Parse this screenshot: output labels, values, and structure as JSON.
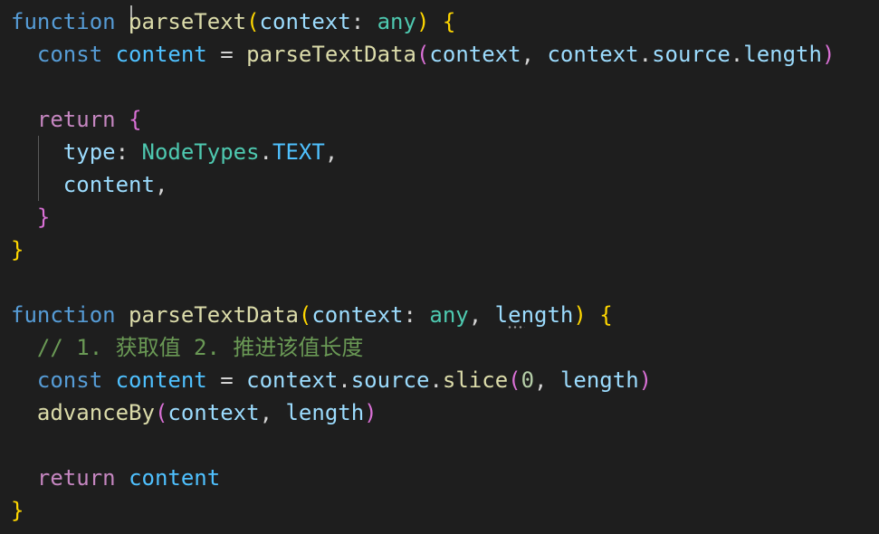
{
  "editor": {
    "language": "typescript",
    "theme_colors": {
      "background": "#1e1e1e",
      "keyword": "#569cd6",
      "control": "#c586c0",
      "function": "#dcdcaa",
      "parameter": "#9cdcfe",
      "constant": "#4fc1ff",
      "type": "#4ec9b0",
      "number": "#b5cea8",
      "comment": "#6a9955",
      "bracket_level1": "#ffd700",
      "bracket_level2": "#da70d6",
      "bracket_level3": "#179fff"
    },
    "lines": [
      [
        {
          "t": "function",
          "c": "kw"
        },
        {
          "t": " ",
          "c": "pun"
        },
        {
          "t": "parseText",
          "c": "fn"
        },
        {
          "t": "(",
          "c": "b1"
        },
        {
          "t": "context",
          "c": "param"
        },
        {
          "t": ": ",
          "c": "pun"
        },
        {
          "t": "any",
          "c": "type"
        },
        {
          "t": ")",
          "c": "b1"
        },
        {
          "t": " ",
          "c": "pun"
        },
        {
          "t": "{",
          "c": "b1"
        }
      ],
      [
        {
          "t": "  ",
          "c": "pun"
        },
        {
          "t": "const",
          "c": "kw"
        },
        {
          "t": " ",
          "c": "pun"
        },
        {
          "t": "content",
          "c": "var"
        },
        {
          "t": " = ",
          "c": "pun"
        },
        {
          "t": "parseTextData",
          "c": "fn"
        },
        {
          "t": "(",
          "c": "b2"
        },
        {
          "t": "context",
          "c": "param"
        },
        {
          "t": ", ",
          "c": "pun"
        },
        {
          "t": "context",
          "c": "param"
        },
        {
          "t": ".",
          "c": "pun"
        },
        {
          "t": "source",
          "c": "param"
        },
        {
          "t": ".",
          "c": "pun"
        },
        {
          "t": "length",
          "c": "param"
        },
        {
          "t": ")",
          "c": "b2"
        }
      ],
      [],
      [
        {
          "t": "  ",
          "c": "pun"
        },
        {
          "t": "return",
          "c": "ctl"
        },
        {
          "t": " ",
          "c": "pun"
        },
        {
          "t": "{",
          "c": "b2"
        }
      ],
      [
        {
          "t": "    ",
          "c": "pun"
        },
        {
          "t": "type",
          "c": "param"
        },
        {
          "t": ": ",
          "c": "pun"
        },
        {
          "t": "NodeTypes",
          "c": "type"
        },
        {
          "t": ".",
          "c": "pun"
        },
        {
          "t": "TEXT",
          "c": "var"
        },
        {
          "t": ",",
          "c": "pun"
        }
      ],
      [
        {
          "t": "    ",
          "c": "pun"
        },
        {
          "t": "content",
          "c": "param"
        },
        {
          "t": ",",
          "c": "pun"
        }
      ],
      [
        {
          "t": "  ",
          "c": "pun"
        },
        {
          "t": "}",
          "c": "b2"
        }
      ],
      [
        {
          "t": "}",
          "c": "b1"
        }
      ],
      [],
      [
        {
          "t": "function",
          "c": "kw"
        },
        {
          "t": " ",
          "c": "pun"
        },
        {
          "t": "parseTextData",
          "c": "fn"
        },
        {
          "t": "(",
          "c": "b1"
        },
        {
          "t": "context",
          "c": "param"
        },
        {
          "t": ": ",
          "c": "pun"
        },
        {
          "t": "any",
          "c": "type"
        },
        {
          "t": ", ",
          "c": "pun"
        },
        {
          "t": "length",
          "c": "param"
        },
        {
          "t": ")",
          "c": "b1"
        },
        {
          "t": " ",
          "c": "pun"
        },
        {
          "t": "{",
          "c": "b1"
        }
      ],
      [
        {
          "t": "  ",
          "c": "pun"
        },
        {
          "t": "// 1. 获取值 2. 推进该值长度",
          "c": "cmt"
        }
      ],
      [
        {
          "t": "  ",
          "c": "pun"
        },
        {
          "t": "const",
          "c": "kw"
        },
        {
          "t": " ",
          "c": "pun"
        },
        {
          "t": "content",
          "c": "var"
        },
        {
          "t": " = ",
          "c": "pun"
        },
        {
          "t": "context",
          "c": "param"
        },
        {
          "t": ".",
          "c": "pun"
        },
        {
          "t": "source",
          "c": "param"
        },
        {
          "t": ".",
          "c": "pun"
        },
        {
          "t": "slice",
          "c": "fn"
        },
        {
          "t": "(",
          "c": "b2"
        },
        {
          "t": "0",
          "c": "num"
        },
        {
          "t": ", ",
          "c": "pun"
        },
        {
          "t": "length",
          "c": "param"
        },
        {
          "t": ")",
          "c": "b2"
        }
      ],
      [
        {
          "t": "  ",
          "c": "pun"
        },
        {
          "t": "advanceBy",
          "c": "fn"
        },
        {
          "t": "(",
          "c": "b2"
        },
        {
          "t": "context",
          "c": "param"
        },
        {
          "t": ", ",
          "c": "pun"
        },
        {
          "t": "length",
          "c": "param"
        },
        {
          "t": ")",
          "c": "b2"
        }
      ],
      [],
      [
        {
          "t": "  ",
          "c": "pun"
        },
        {
          "t": "return",
          "c": "ctl"
        },
        {
          "t": " ",
          "c": "pun"
        },
        {
          "t": "content",
          "c": "var"
        }
      ],
      [
        {
          "t": "}",
          "c": "b1"
        }
      ]
    ]
  }
}
